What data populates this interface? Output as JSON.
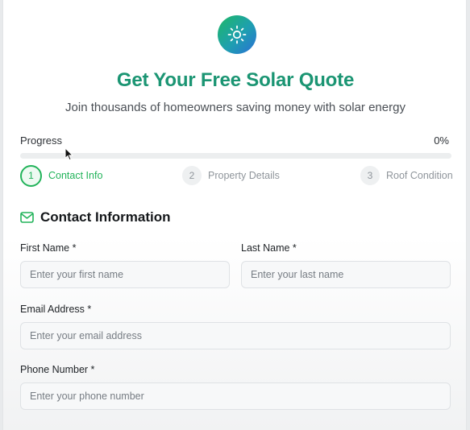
{
  "header": {
    "logo_icon": "sun-icon",
    "title": "Get Your Free Solar Quote",
    "subtitle": "Join thousands of homeowners saving money with solar energy"
  },
  "progress": {
    "label": "Progress",
    "value_text": "0%",
    "value": 0
  },
  "steps": [
    {
      "number": "1",
      "label": "Contact Info",
      "state": "active"
    },
    {
      "number": "2",
      "label": "Property Details",
      "state": "inactive"
    },
    {
      "number": "3",
      "label": "Roof Condition",
      "state": "inactive"
    }
  ],
  "section": {
    "icon": "mail-icon",
    "title": "Contact Information"
  },
  "form": {
    "first_name": {
      "label": "First Name *",
      "placeholder": "Enter your first name",
      "value": ""
    },
    "last_name": {
      "label": "Last Name *",
      "placeholder": "Enter your last name",
      "value": ""
    },
    "email": {
      "label": "Email Address *",
      "placeholder": "Enter your email address",
      "value": ""
    },
    "phone": {
      "label": "Phone Number *",
      "placeholder": "Enter your phone number",
      "value": ""
    }
  },
  "colors": {
    "accent_green": "#22b35a",
    "title_teal": "#1b9573",
    "logo_gradient": [
      "#1fb866",
      "#2b6fd6"
    ]
  }
}
